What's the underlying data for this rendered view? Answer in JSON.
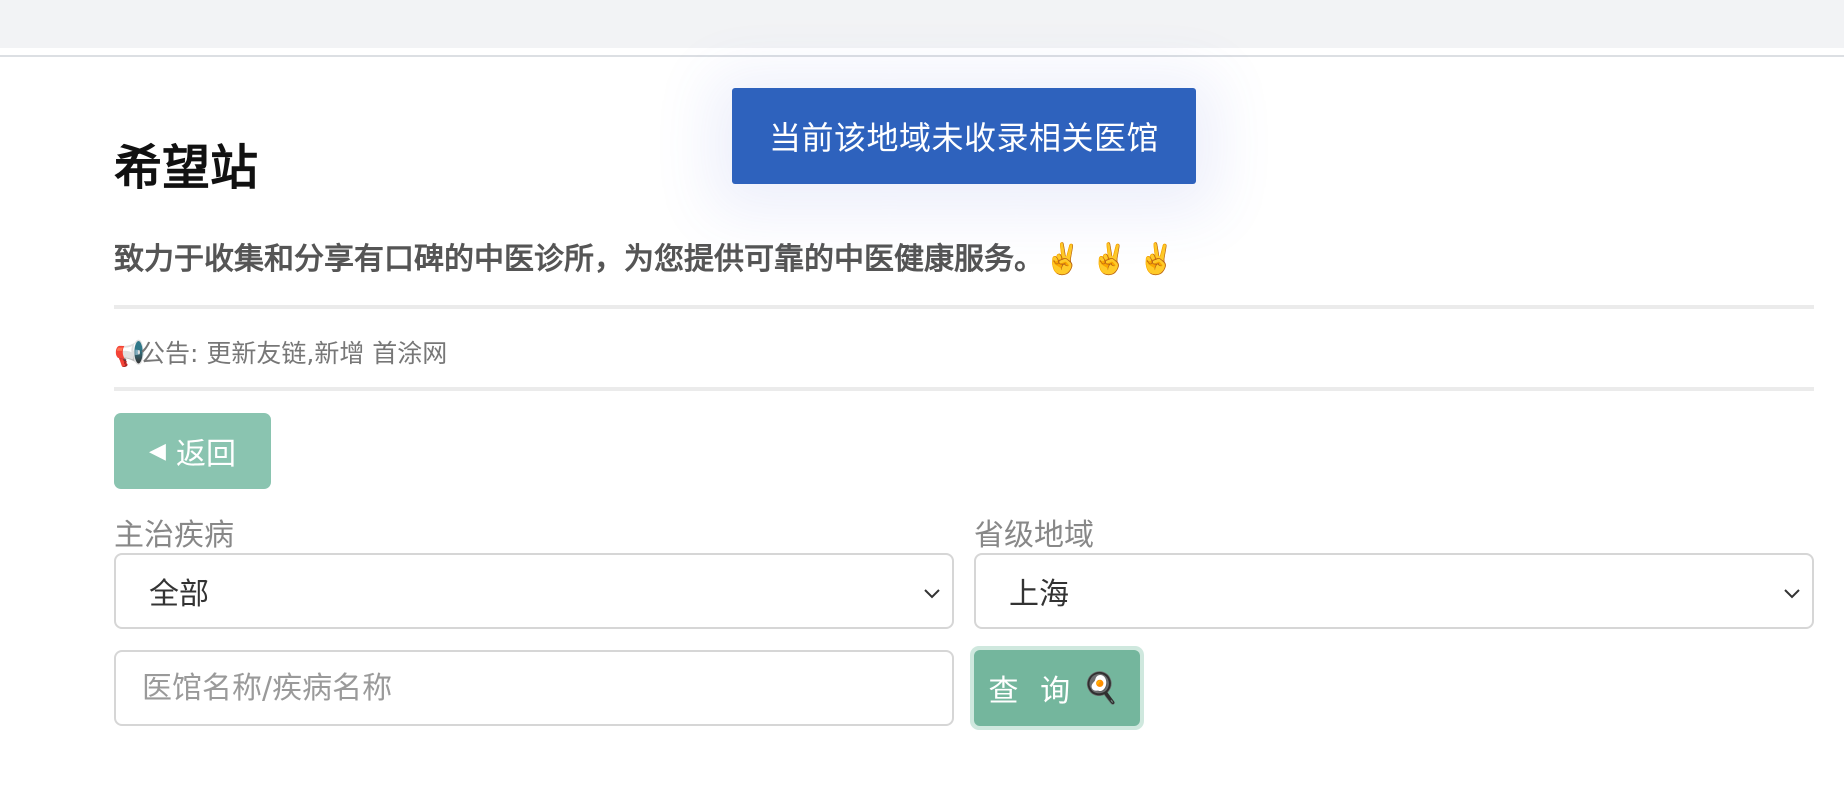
{
  "toast": {
    "message": "当前该地域未收录相关医馆"
  },
  "header": {
    "title": "希望站",
    "subtitle": "致力于收集和分享有口碑的中医诊所，为您提供可靠的中医健康服务。",
    "subtitle_emoji": "✌️ ✌️ ✌️"
  },
  "notice": {
    "icon": "megaphone-icon",
    "icon_glyph": "📢",
    "text": "公告: 更新友链,新增 首涂网"
  },
  "back_button": {
    "arrow": "◀",
    "label": "返回"
  },
  "filters": {
    "disease": {
      "label": "主治疾病",
      "selected": "全部"
    },
    "province": {
      "label": "省级地域",
      "selected": "上海"
    }
  },
  "search": {
    "placeholder": "医馆名称/疾病名称",
    "button_label": "查 询",
    "button_icon": "🍳"
  },
  "colors": {
    "toast_bg": "#2e62bd",
    "back_button_bg": "#8ac4b0",
    "query_button_bg": "#74b69d"
  }
}
